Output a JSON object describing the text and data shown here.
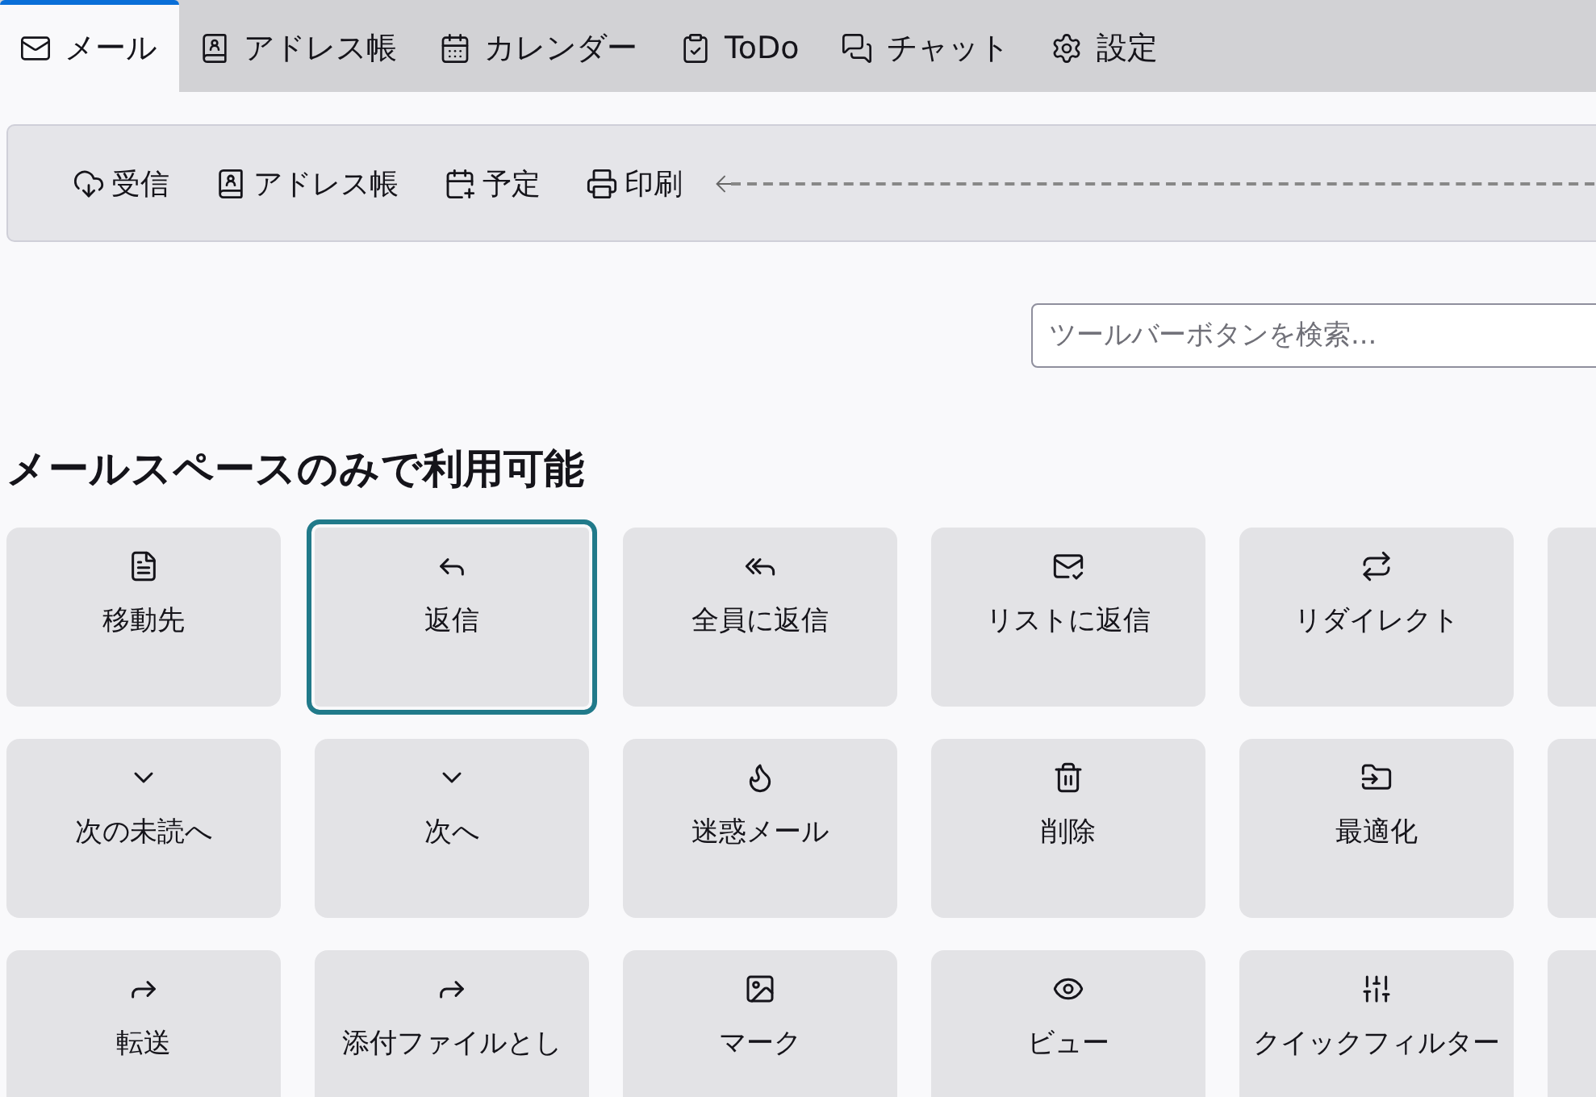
{
  "tabs": [
    {
      "label": "メール",
      "selected": true
    },
    {
      "label": "アドレス帳",
      "selected": false
    },
    {
      "label": "カレンダー",
      "selected": false
    },
    {
      "label": "ToDo",
      "selected": false
    },
    {
      "label": "チャット",
      "selected": false
    },
    {
      "label": "設定",
      "selected": false
    }
  ],
  "toolbar": {
    "buttons": [
      "受信",
      "アドレス帳",
      "予定",
      "印刷"
    ]
  },
  "search": {
    "placeholder": "ツールバーボタンを検索..."
  },
  "section": {
    "title": "メールスペースのみで利用可能",
    "buttons": [
      {
        "label": "移動先",
        "selected": false
      },
      {
        "label": "返信",
        "selected": true
      },
      {
        "label": "全員に返信",
        "selected": false
      },
      {
        "label": "リストに返信",
        "selected": false
      },
      {
        "label": "リダイレクト",
        "selected": false
      },
      {
        "label": "次の未読へ",
        "selected": false
      },
      {
        "label": "次へ",
        "selected": false
      },
      {
        "label": "迷惑メール",
        "selected": false
      },
      {
        "label": "削除",
        "selected": false
      },
      {
        "label": "最適化",
        "selected": false
      },
      {
        "label": "転送",
        "selected": false
      },
      {
        "label": "添付ファイルとし",
        "selected": false
      },
      {
        "label": "マーク",
        "selected": false
      },
      {
        "label": "ビュー",
        "selected": false
      },
      {
        "label": "クイックフィルター",
        "selected": false
      }
    ]
  }
}
